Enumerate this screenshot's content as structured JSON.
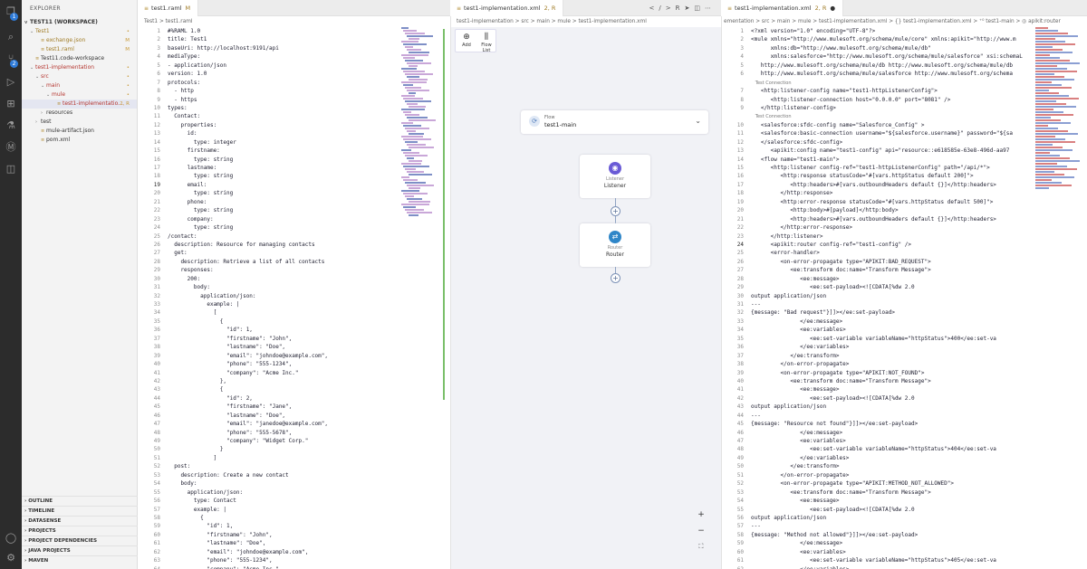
{
  "explorer": {
    "title": "EXPLORER",
    "workspace": "TEST11 (WORKSPACE)",
    "items": [
      {
        "label": "Test1",
        "level": 1,
        "arrow": "v",
        "mark": "•",
        "cls": "mod-row"
      },
      {
        "label": "exchange.json",
        "level": 2,
        "arrow": "",
        "mark": "M",
        "cls": "mod-row"
      },
      {
        "label": "test1.raml",
        "level": 2,
        "arrow": "",
        "mark": "M",
        "cls": "mod-row"
      },
      {
        "label": "Test11.code-workspace",
        "level": 1,
        "arrow": "",
        "mark": "",
        "cls": ""
      },
      {
        "label": "test1-implementation",
        "level": 1,
        "arrow": "v",
        "mark": "•",
        "cls": "err-row"
      },
      {
        "label": "src",
        "level": 2,
        "arrow": "v",
        "mark": "•",
        "cls": "err-row"
      },
      {
        "label": "main",
        "level": 3,
        "arrow": "v",
        "mark": "•",
        "cls": "err-row"
      },
      {
        "label": "mule",
        "level": 4,
        "arrow": "v",
        "mark": "•",
        "cls": "err-row"
      },
      {
        "label": "test1-implementatio...",
        "level": 5,
        "arrow": "",
        "mark": "2, R",
        "cls": "err-row selected"
      },
      {
        "label": "resources",
        "level": 3,
        "arrow": ">",
        "mark": "",
        "cls": ""
      },
      {
        "label": "test",
        "level": 2,
        "arrow": ">",
        "mark": "",
        "cls": ""
      },
      {
        "label": "mule-artifact.json",
        "level": 2,
        "arrow": "",
        "mark": "",
        "cls": ""
      },
      {
        "label": "pom.xml",
        "level": 2,
        "arrow": "",
        "mark": "",
        "cls": ""
      }
    ],
    "sections": [
      "OUTLINE",
      "TIMELINE",
      "DATASENSE",
      "PROJECTS",
      "PROJECT DEPENDENCIES",
      "JAVA PROJECTS",
      "MAVEN"
    ]
  },
  "raml": {
    "tab_label": "test1.raml",
    "tab_mark": "M",
    "breadcrumb": "Test1 > test1.raml",
    "lines": [
      "#%RAML 1.0",
      "title: Test1",
      "baseUri: http://localhost:9191/api",
      "mediaType:",
      "- application/json",
      "version: 1.0",
      "protocols:",
      "  - http",
      "  - https",
      "types:",
      "  Contact:",
      "    properties:",
      "      id:",
      "        type: integer",
      "      firstname:",
      "        type: string",
      "      lastname:",
      "        type: string",
      "      email:",
      "        type: string",
      "      phone:",
      "        type: string",
      "      company:",
      "        type: string",
      "/contact:",
      "  description: Resource for managing contacts",
      "  get:",
      "    description: Retrieve a list of all contacts",
      "    responses:",
      "      200:",
      "        body:",
      "          application/json:",
      "            example: |",
      "              [",
      "                {",
      "                  \"id\": 1,",
      "                  \"firstname\": \"John\",",
      "                  \"lastname\": \"Doe\",",
      "                  \"email\": \"johndoe@example.com\",",
      "                  \"phone\": \"555-1234\",",
      "                  \"company\": \"Acme Inc.\"",
      "                },",
      "                {",
      "                  \"id\": 2,",
      "                  \"firstname\": \"Jane\",",
      "                  \"lastname\": \"Doe\",",
      "                  \"email\": \"janedoe@example.com\",",
      "                  \"phone\": \"555-5678\",",
      "                  \"company\": \"Widget Corp.\"",
      "                }",
      "              ]",
      "  post:",
      "    description: Create a new contact",
      "    body:",
      "      application/json:",
      "        type: Contact",
      "        example: |",
      "          {",
      "            \"id\": 1,",
      "            \"firstname\": \"John\",",
      "            \"lastname\": \"Doe\",",
      "            \"email\": \"johndoe@example.com\",",
      "            \"phone\": \"555-1234\",",
      "            \"company\": \"Acme Inc.\""
    ]
  },
  "flow": {
    "tab_label": "test1-implementation.xml",
    "tab_mark": "2, R",
    "breadcrumb": "test1-implementation > src > main > mule > test1-implementation.xml",
    "tools": [
      {
        "icon": "⊕",
        "label": "Add"
      },
      {
        "icon": "⫼",
        "label": "Flow List"
      }
    ],
    "flow_label": "Flow",
    "flow_name": "test1-main",
    "listener": {
      "label1": "Listener",
      "label2": "Listener"
    },
    "router": {
      "label1": "Router",
      "label2": "Router"
    },
    "zoom": [
      "+",
      "−",
      "⛶"
    ]
  },
  "xml": {
    "tab_label": "test1-implementation.xml",
    "tab_mark": "2, R",
    "breadcrumb": "ementation > src > main > mule > test1-implementation.xml > {} test1-implementation.xml > ⁺⁰ test1-main > ◎ apikit:router",
    "lines": [
      {
        "n": "1",
        "t": "<?xml version=\"1.0\" encoding=\"UTF-8\"?>"
      },
      {
        "n": "2",
        "t": "<mule xmlns=\"http://www.mulesoft.org/schema/mule/core\" xmlns:apikit=\"http://www.m"
      },
      {
        "n": "3",
        "t": "      xmlns:db=\"http://www.mulesoft.org/schema/mule/db\""
      },
      {
        "n": "4",
        "t": "      xmlns:salesforce=\"http://www.mulesoft.org/schema/mule/salesforce\" xsi:schemaL"
      },
      {
        "n": "5",
        "t": "   http://www.mulesoft.org/schema/mule/db http://www.mulesoft.org/schema/mule/db"
      },
      {
        "n": "6",
        "t": "   http://www.mulesoft.org/schema/mule/salesforce http://www.mulesoft.org/schema"
      },
      {
        "n": "",
        "t": "   Test Connection"
      },
      {
        "n": "7",
        "t": "   <http:listener-config name=\"test1-httpListenerConfig\">"
      },
      {
        "n": "8",
        "t": "      <http:listener-connection host=\"0.0.0.0\" port=\"8081\" />"
      },
      {
        "n": "9",
        "t": "   </http:listener-config>"
      },
      {
        "n": "",
        "t": "   Test Connection"
      },
      {
        "n": "10",
        "t": "   <salesforce:sfdc-config name=\"Salesforce_Config\" >"
      },
      {
        "n": "11",
        "t": "   <salesforce:basic-connection username=\"${salesforce.username}\" password=\"${sa"
      },
      {
        "n": "12",
        "t": "   </salesforce:sfdc-config>"
      },
      {
        "n": "13",
        "t": "      <apikit:config name=\"test1-config\" api=\"resource::e618585e-63e8-496d-aa97"
      },
      {
        "n": "14",
        "t": "   <flow name=\"test1-main\">"
      },
      {
        "n": "15",
        "t": "      <http:listener config-ref=\"test1-httpListenerConfig\" path=\"/api/*\">"
      },
      {
        "n": "16",
        "t": "         <http:response statusCode=\"#[vars.httpStatus default 200]\">"
      },
      {
        "n": "17",
        "t": "            <http:headers>#[vars.outboundHeaders default {}]</http:headers>"
      },
      {
        "n": "18",
        "t": "         </http:response>"
      },
      {
        "n": "19",
        "t": "         <http:error-response statusCode=\"#[vars.httpStatus default 500]\">"
      },
      {
        "n": "20",
        "t": "            <http:body>#[payload]</http:body>"
      },
      {
        "n": "21",
        "t": "            <http:headers>#[vars.outboundHeaders default {}]</http:headers>"
      },
      {
        "n": "22",
        "t": "         </http:error-response>"
      },
      {
        "n": "23",
        "t": "      </http:listener>"
      },
      {
        "n": "24",
        "t": "      <apikit:router config-ref=\"test1-config\" />"
      },
      {
        "n": "25",
        "t": "      <error-handler>"
      },
      {
        "n": "26",
        "t": "         <on-error-propagate type=\"APIKIT:BAD_REQUEST\">"
      },
      {
        "n": "27",
        "t": "            <ee:transform doc:name=\"Transform Message\">"
      },
      {
        "n": "28",
        "t": "               <ee:message>"
      },
      {
        "n": "29",
        "t": "                  <ee:set-payload><![CDATA[%dw 2.0"
      },
      {
        "n": "30",
        "t": "output application/json"
      },
      {
        "n": "31",
        "t": "---"
      },
      {
        "n": "32",
        "t": "{message: \"Bad request\"}]]></ee:set-payload>"
      },
      {
        "n": "33",
        "t": "               </ee:message>"
      },
      {
        "n": "34",
        "t": "               <ee:variables>"
      },
      {
        "n": "35",
        "t": "                  <ee:set-variable variableName=\"httpStatus\">400</ee:set-va"
      },
      {
        "n": "36",
        "t": "               </ee:variables>"
      },
      {
        "n": "37",
        "t": "            </ee:transform>"
      },
      {
        "n": "38",
        "t": "         </on-error-propagate>"
      },
      {
        "n": "39",
        "t": "         <on-error-propagate type=\"APIKIT:NOT_FOUND\">"
      },
      {
        "n": "40",
        "t": "            <ee:transform doc:name=\"Transform Message\">"
      },
      {
        "n": "41",
        "t": "               <ee:message>"
      },
      {
        "n": "42",
        "t": "                  <ee:set-payload><![CDATA[%dw 2.0"
      },
      {
        "n": "43",
        "t": "output application/json"
      },
      {
        "n": "44",
        "t": "---"
      },
      {
        "n": "45",
        "t": "{message: \"Resource not found\"}]]></ee:set-payload>"
      },
      {
        "n": "46",
        "t": "               </ee:message>"
      },
      {
        "n": "47",
        "t": "               <ee:variables>"
      },
      {
        "n": "48",
        "t": "                  <ee:set-variable variableName=\"httpStatus\">404</ee:set-va"
      },
      {
        "n": "49",
        "t": "               </ee:variables>"
      },
      {
        "n": "50",
        "t": "            </ee:transform>"
      },
      {
        "n": "51",
        "t": "         </on-error-propagate>"
      },
      {
        "n": "52",
        "t": "         <on-error-propagate type=\"APIKIT:METHOD_NOT_ALLOWED\">"
      },
      {
        "n": "53",
        "t": "            <ee:transform doc:name=\"Transform Message\">"
      },
      {
        "n": "54",
        "t": "               <ee:message>"
      },
      {
        "n": "55",
        "t": "                  <ee:set-payload><![CDATA[%dw 2.0"
      },
      {
        "n": "56",
        "t": "output application/json"
      },
      {
        "n": "57",
        "t": "---"
      },
      {
        "n": "58",
        "t": "{message: \"Method not allowed\"}]]></ee:set-payload>"
      },
      {
        "n": "59",
        "t": "               </ee:message>"
      },
      {
        "n": "60",
        "t": "               <ee:variables>"
      },
      {
        "n": "61",
        "t": "                  <ee:set-variable variableName=\"httpStatus\">405</ee:set-va"
      },
      {
        "n": "62",
        "t": "               </ee:variables>"
      }
    ]
  }
}
